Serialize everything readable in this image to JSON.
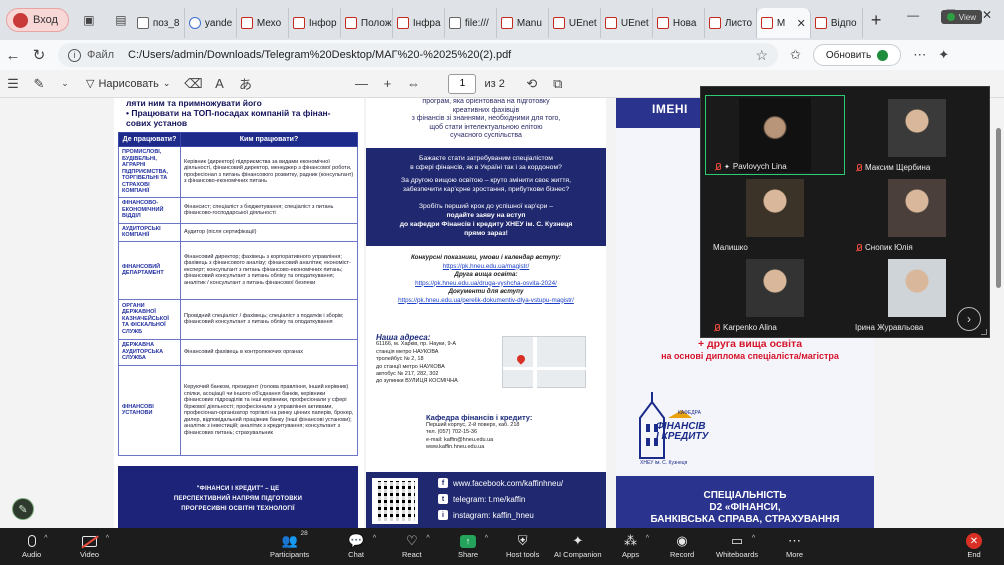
{
  "browser": {
    "profile_label": "Вход",
    "tabs": [
      {
        "label": "поз_8"
      },
      {
        "label": "yande"
      },
      {
        "label": "Мехо"
      },
      {
        "label": "Інфор"
      },
      {
        "label": "Полож"
      },
      {
        "label": "Інфра"
      },
      {
        "label": "file:///"
      },
      {
        "label": "Manu"
      },
      {
        "label": "UEnet"
      },
      {
        "label": "UEnet"
      },
      {
        "label": "Нова"
      },
      {
        "label": "Листо"
      },
      {
        "label": "М"
      },
      {
        "label": "Відпо"
      }
    ],
    "view_badge": "View",
    "address": {
      "site_label": "Файл",
      "url": "C:/Users/admin/Downloads/Telegram%20Desktop/МАГ%20-%2025%20(2).pdf"
    },
    "update_button": "Обновить"
  },
  "pdf_toolbar": {
    "draw_label": "Нарисовать",
    "zoom_minus": "—",
    "zoom_plus": "+",
    "page_current": "1",
    "page_total": "из 2"
  },
  "page1": {
    "head_lines": [
      "ляти ним та примножувати його",
      "•  Працювати на ТОП-посадах компаній та фінан-",
      "    сових установ"
    ],
    "col1_header": "Де працювати?",
    "col2_header": "Ким працювати?",
    "rows": [
      {
        "where": "ПРОМИСЛОВІ, БУДІВЕЛЬНІ, АГРАРНІ ПІДПРИЄМСТВА, ТОРГІВЕЛЬНІ ТА СТРАХОВІ КОМПАНІЇ",
        "who": "Керівник (директор) підприємства за видами економічної діяльності, фінансовий директор, менеджер з фінансової роботи, професіонал з питань фінансового розвитку, радник (консультант) з фінансово-економічних питань"
      },
      {
        "where": "ФІНАНСОВО-ЕКОНОМІЧНИЙ ВІДДІЛ",
        "who": "Фінансист; спеціаліст з бюджетування; спеціаліст з питань фінансово-господарської діяльності"
      },
      {
        "where": "АУДИТОРСЬКІ КОМПАНІЇ",
        "who": "Аудитор (після сертифікації)"
      },
      {
        "where": "ФІНАНСОВИЙ ДЕПАРТАМЕНТ",
        "who": "Фінансовий директор; фахівець з корпоративного управління; фахівець з фінансового аналізу; фінансовий аналітик; економіст-експерт; консультант з питань фінансово-економічних питань; фінансовий консультант з питань обліку та оподаткування; аналітик / консультант з питань фінансової безпеки"
      },
      {
        "where": "ОРГАНИ ДЕРЖАВНОЇ КАЗНАЧЕЙСЬКОЇ ТА ФІСКАЛЬНОЇ СЛУЖБ",
        "who": "Провідний спеціаліст / фахівець; спеціаліст з податків і зборів; фінансовий консультант з питань обліку та оподаткування"
      },
      {
        "where": "ДЕРЖАВНА АУДИТОРСЬКА СЛУЖБА",
        "who": "Фінансовий фахівець  в контролюючих органах"
      },
      {
        "where": "ФІНАНСОВІ УСТАНОВИ",
        "who": "Керуючий банком, президент (голова правління, інший керівник) спілки, асоціації чи іншого об'єднання банків, керівники фінансових підрозділів та інші керівники, професіонали у сфері біржової діяльності; професіонали з управління активами, професіонал-організатор торгівлі на ринку цінних паперів, брокер, дилер, відповідальний працівник банку (інші фінансові установи); аналітик з інвестицій; аналітик з кредитування; консультант з фінансових питань; страхувальник"
      }
    ],
    "footer_lines": [
      "\"ФІНАНСИ І КРЕДИТ\" – ЦЕ",
      "ПЕРСПЕКТИВНИЙ НАПРЯМ  ПІДГОТОВКИ",
      "ПРОГРЕСИВНІ ОСВІТНІ ТЕХНОЛОГІЇ"
    ]
  },
  "page2": {
    "top_lines": [
      "програм, яка орієнтована на підготовку",
      "креативних фахівців",
      "з фінансів зі знаннями, необхідними для того,",
      "щоб стати інтелектуальною елітою",
      "сучасного суспільства"
    ],
    "blue_lines": [
      "Бажаєте стати затребуваним спеціалістом",
      "в сфері фінансів, як в Україні так і за кордоном?",
      "За другою вищою освітою – круто змінити своє життя,",
      "забезпечити кар'єрне зростання, прибуткови бізнес?",
      "Зробіть перший крок до успішної кар'єри –",
      "подайте заяву на вступ",
      "до кафедри Фінансів і кредиту ХНЕУ ім. С. Кузнеця",
      "прямо зараз!"
    ],
    "mid_lines": [
      {
        "text": "Конкурсні показники, умови і календар вступу:",
        "kind": "b"
      },
      {
        "text": "https://pk.hneu.edu.ua/magistr/",
        "kind": "lnk"
      },
      {
        "text": "Друга вища освіта:",
        "kind": "b"
      },
      {
        "text": "https://pk.hneu.edu.ua/druga-vyshcha-osvita-2024/",
        "kind": "lnk"
      },
      {
        "text": "Документи для вступу",
        "kind": "b"
      },
      {
        "text": "https://pk.hneu.edu.ua/perelik-dokumentiv-dlya-vstupu-magistr/",
        "kind": "lnk"
      }
    ],
    "address_head": "Наша адреса:",
    "address_lines": [
      "61166, м. Харків, пр. Науки, 9-А",
      "станція метро  НАУКОВА",
      "тролейбус № 2, 18",
      "до станції метро НАУКОВА",
      "автобус  № 217, 282, 302",
      "до зупинки ВУЛИЦЯ КОСМІЧНА"
    ],
    "dept_head": "Кафедра фінансів і кредиту:",
    "dept_lines": [
      "Перший корпус, 2-й поверх, каб. 218",
      "тел. (057) 702-15-36",
      "e-mail: kaffin@hneu.edu.ua",
      "www.kaffin.hneu.edu.ua"
    ],
    "social": [
      {
        "icon": "f",
        "text": "www.facebook.com/kaffinhneu/"
      },
      {
        "icon": "t",
        "text": "telegram: t.me/kaffin"
      },
      {
        "icon": "i",
        "text": "instagram: kaffin_hneu"
      }
    ]
  },
  "page3": {
    "top_text": "ІМЕНІ",
    "red_lines": [
      "+ друга вища освіта",
      "на основі диплома спеціаліста/магістра"
    ],
    "logo_kaf": "КАФЕДРА",
    "logo_brand": [
      "ФІНАНСІВ",
      "І КРЕДИТУ"
    ],
    "logo_univ": "ХНЕУ ім. С. Кузнеця",
    "bottom_lines": [
      "СПЕЦІАЛЬНІСТЬ",
      "D2 «ФІНАНСИ,",
      "БАНКІВСЬКА СПРАВА, СТРАХУВАННЯ"
    ]
  },
  "zoom_panel": {
    "participants": [
      {
        "name": "Pavlovych Lina",
        "muted": true,
        "pinned": true,
        "speaking": true
      },
      {
        "name": "Максим Щербина",
        "muted": true
      },
      {
        "name": "Малишко",
        "muted": false
      },
      {
        "name": "Снопик Юлія",
        "muted": true
      },
      {
        "name": "Karpenko Alina",
        "muted": true
      },
      {
        "name": "Ірина Журавльова",
        "muted": false
      }
    ]
  },
  "zoom_toolbar": {
    "audio": "Audio",
    "video": "Video",
    "participants": "Participants",
    "participants_count": "28",
    "chat": "Chat",
    "react": "React",
    "share": "Share",
    "host_tools": "Host tools",
    "ai_companion": "AI Companion",
    "apps": "Apps",
    "record": "Record",
    "whiteboards": "Whiteboards",
    "more": "More",
    "end": "End"
  },
  "colors": {
    "brand_blue": "#20296f",
    "accent_red": "#d6152b",
    "zoom_green": "#23a45a",
    "end_red": "#d93025"
  }
}
